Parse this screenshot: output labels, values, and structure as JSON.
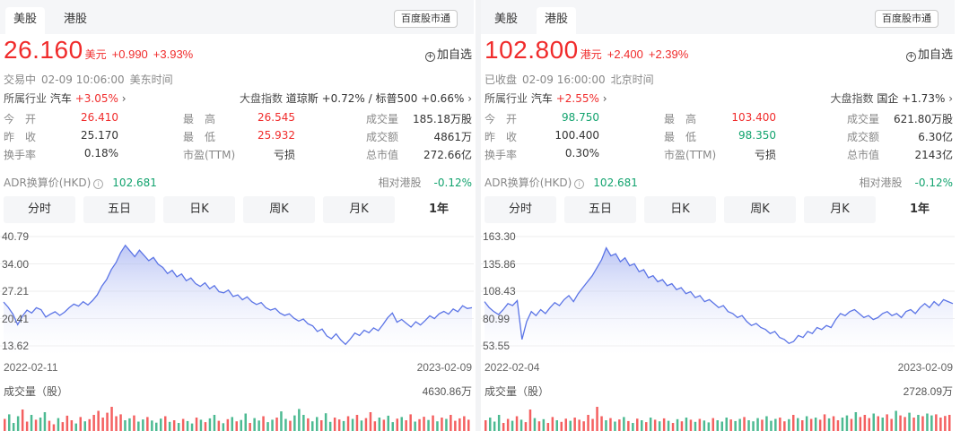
{
  "panels": [
    {
      "market_tabs": [
        "美股",
        "港股"
      ],
      "active_market": 0,
      "badge": "百度股市通",
      "price": "26.160",
      "currency": "美元",
      "change": "+0.990",
      "change_pct": "+3.93%",
      "watch_label": "加自选",
      "status": {
        "state": "交易中",
        "time": "02-09 10:06:00",
        "tz": "美东时间"
      },
      "industry": {
        "label": "所属行业",
        "name": "汽车",
        "pct": "+3.05%"
      },
      "market_index": {
        "label": "大盘指数",
        "text": "道琼斯 +0.72% / 标普500 +0.66%"
      },
      "stats": [
        [
          {
            "label": "今　开",
            "value": "26.410",
            "tone": "up"
          },
          {
            "label": "最　高",
            "value": "26.545",
            "tone": "up"
          },
          {
            "label": "成交量",
            "value": "185.18万股",
            "tone": ""
          }
        ],
        [
          {
            "label": "昨　收",
            "value": "25.170",
            "tone": ""
          },
          {
            "label": "最　低",
            "value": "25.932",
            "tone": "up"
          },
          {
            "label": "成交额",
            "value": "4861万",
            "tone": ""
          }
        ],
        [
          {
            "label": "换手率",
            "value": "0.18%",
            "tone": ""
          },
          {
            "label": "市盈(TTM)",
            "value": "亏损",
            "tone": ""
          },
          {
            "label": "总市值",
            "value": "272.66亿",
            "tone": ""
          }
        ]
      ],
      "adr": {
        "label": "ADR换算价(HKD)",
        "value": "102.681"
      },
      "relative": {
        "label": "相对港股",
        "value": "-0.12%"
      },
      "period_tabs": [
        "分时",
        "五日",
        "日K",
        "周K",
        "月K",
        "1年"
      ],
      "active_period": 5,
      "chart_data": {
        "type": "area",
        "y_ticks": [
          "40.79",
          "34.00",
          "27.21",
          "20.41",
          "13.62"
        ],
        "ylim": [
          13.62,
          40.79
        ],
        "x_start": "2022-02-11",
        "x_end": "2023-02-09",
        "values": [
          24.5,
          23.2,
          21.5,
          18.9,
          21.0,
          22.5,
          21.8,
          23.1,
          22.6,
          20.8,
          21.5,
          22.1,
          21.2,
          22.0,
          23.1,
          24.0,
          23.5,
          24.6,
          23.8,
          24.9,
          26.3,
          28.5,
          30.1,
          32.6,
          34.3,
          36.8,
          38.6,
          37.2,
          35.8,
          37.4,
          36.1,
          34.8,
          35.6,
          33.9,
          33.1,
          31.6,
          32.4,
          30.8,
          31.5,
          29.8,
          30.5,
          29.1,
          28.4,
          29.3,
          27.8,
          28.6,
          27.1,
          26.8,
          27.5,
          25.9,
          26.3,
          25.1,
          25.8,
          24.6,
          23.9,
          24.4,
          23.1,
          22.5,
          22.9,
          21.8,
          21.2,
          21.6,
          20.5,
          19.8,
          20.3,
          19.1,
          18.6,
          17.2,
          17.8,
          16.1,
          15.4,
          16.6,
          15.1,
          14.0,
          15.3,
          16.8,
          16.2,
          17.5,
          16.9,
          18.1,
          17.4,
          18.9,
          20.6,
          21.8,
          19.5,
          20.2,
          19.2,
          18.3,
          19.6,
          18.8,
          19.9,
          21.1,
          20.4,
          21.6,
          22.2,
          21.5,
          22.8,
          22.1,
          23.6,
          22.9,
          23.1
        ]
      },
      "volume": {
        "label": "成交量（股）",
        "max_text": "4630.86万",
        "bars": [
          0.45,
          0.62,
          0.3,
          0.55,
          0.8,
          0.35,
          0.6,
          0.42,
          0.5,
          0.7,
          0.38,
          0.25,
          0.48,
          0.33,
          0.57,
          0.4,
          0.28,
          0.52,
          0.36,
          0.44,
          0.6,
          0.75,
          0.5,
          0.68,
          0.9,
          0.55,
          0.62,
          0.4,
          0.47,
          0.58,
          0.35,
          0.43,
          0.52,
          0.39,
          0.31,
          0.46,
          0.55,
          0.34,
          0.4,
          0.3,
          0.45,
          0.37,
          0.28,
          0.5,
          0.42,
          0.33,
          0.47,
          0.6,
          0.38,
          0.29,
          0.44,
          0.52,
          0.36,
          0.41,
          0.65,
          0.3,
          0.48,
          0.39,
          0.55,
          0.33,
          0.42,
          0.5,
          0.73,
          0.45,
          0.38,
          0.58,
          0.82,
          0.6,
          0.47,
          0.36,
          0.52,
          0.4,
          0.66,
          0.34,
          0.5,
          0.43,
          0.37,
          0.55,
          0.45,
          0.6,
          0.39,
          0.48,
          0.7,
          0.36,
          0.5,
          0.42,
          0.57,
          0.33,
          0.46,
          0.52,
          0.4,
          0.62,
          0.35,
          0.44,
          0.53,
          0.41,
          0.58,
          0.36,
          0.5,
          0.45,
          0.6,
          0.38,
          0.47,
          0.55,
          0.42
        ]
      }
    },
    {
      "market_tabs": [
        "美股",
        "港股"
      ],
      "active_market": 1,
      "badge": "百度股市通",
      "price": "102.800",
      "currency": "港元",
      "change": "+2.400",
      "change_pct": "+2.39%",
      "watch_label": "加自选",
      "status": {
        "state": "已收盘",
        "time": "02-09 16:00:00",
        "tz": "北京时间"
      },
      "industry": {
        "label": "所属行业",
        "name": "汽车",
        "pct": "+2.55%"
      },
      "market_index": {
        "label": "大盘指数",
        "text": "国企 +1.73%"
      },
      "stats": [
        [
          {
            "label": "今　开",
            "value": "98.750",
            "tone": "down"
          },
          {
            "label": "最　高",
            "value": "103.400",
            "tone": "up"
          },
          {
            "label": "成交量",
            "value": "621.80万股",
            "tone": ""
          }
        ],
        [
          {
            "label": "昨　收",
            "value": "100.400",
            "tone": ""
          },
          {
            "label": "最　低",
            "value": "98.350",
            "tone": "down"
          },
          {
            "label": "成交额",
            "value": "6.30亿",
            "tone": ""
          }
        ],
        [
          {
            "label": "换手率",
            "value": "0.30%",
            "tone": ""
          },
          {
            "label": "市盈(TTM)",
            "value": "亏损",
            "tone": ""
          },
          {
            "label": "总市值",
            "value": "2143亿",
            "tone": ""
          }
        ]
      ],
      "adr": {
        "label": "ADR换算价(HKD)",
        "value": "102.681"
      },
      "relative": {
        "label": "相对港股",
        "value": "-0.12%"
      },
      "period_tabs": [
        "分时",
        "五日",
        "日K",
        "周K",
        "月K",
        "1年"
      ],
      "active_period": 5,
      "chart_data": {
        "type": "area",
        "y_ticks": [
          "163.30",
          "135.86",
          "108.43",
          "80.99",
          "53.55"
        ],
        "ylim": [
          53.55,
          163.3
        ],
        "x_start": "2022-02-04",
        "x_end": "2023-02-09",
        "values": [
          98,
          92,
          88,
          85,
          90,
          96,
          94,
          99,
          60,
          78,
          88,
          84,
          90,
          86,
          92,
          97,
          94,
          100,
          104,
          98,
          106,
          112,
          118,
          124,
          132,
          140,
          152,
          144,
          146,
          138,
          142,
          134,
          136,
          128,
          130,
          122,
          124,
          118,
          120,
          114,
          116,
          110,
          112,
          106,
          108,
          102,
          104,
          98,
          100,
          96,
          92,
          94,
          88,
          86,
          82,
          84,
          78,
          74,
          76,
          72,
          70,
          66,
          68,
          62,
          60,
          56,
          58,
          64,
          62,
          68,
          66,
          72,
          70,
          74,
          72,
          80,
          86,
          84,
          88,
          90,
          86,
          82,
          84,
          80,
          82,
          86,
          88,
          84,
          86,
          82,
          88,
          90,
          86,
          92,
          96,
          92,
          98,
          94,
          100,
          98,
          96
        ]
      },
      "volume": {
        "label": "成交量（股）",
        "max_text": "2728.09万",
        "bars": [
          0.4,
          0.5,
          0.35,
          0.6,
          0.3,
          0.45,
          0.38,
          0.55,
          0.42,
          0.33,
          0.8,
          0.48,
          0.36,
          0.44,
          0.3,
          0.52,
          0.4,
          0.34,
          0.46,
          0.38,
          0.5,
          0.42,
          0.36,
          0.6,
          0.45,
          0.9,
          0.55,
          0.4,
          0.48,
          0.35,
          0.43,
          0.52,
          0.37,
          0.3,
          0.46,
          0.4,
          0.33,
          0.5,
          0.42,
          0.36,
          0.47,
          0.38,
          0.3,
          0.44,
          0.36,
          0.5,
          0.42,
          0.34,
          0.45,
          0.39,
          0.32,
          0.48,
          0.4,
          0.35,
          0.5,
          0.43,
          0.37,
          0.45,
          0.52,
          0.4,
          0.36,
          0.48,
          0.42,
          0.55,
          0.38,
          0.45,
          0.5,
          0.36,
          0.44,
          0.6,
          0.48,
          0.4,
          0.55,
          0.45,
          0.5,
          0.42,
          0.62,
          0.47,
          0.55,
          0.4,
          0.5,
          0.58,
          0.45,
          0.7,
          0.52,
          0.6,
          0.48,
          0.65,
          0.55,
          0.5,
          0.62,
          0.45,
          0.75,
          0.58,
          0.52,
          0.68,
          0.5,
          0.6,
          0.55,
          0.65,
          0.58,
          0.62,
          0.5,
          0.56,
          0.6
        ]
      }
    }
  ],
  "colors": {
    "up": "#f02b2b",
    "down": "#12a36e",
    "line": "#5b74e6"
  }
}
